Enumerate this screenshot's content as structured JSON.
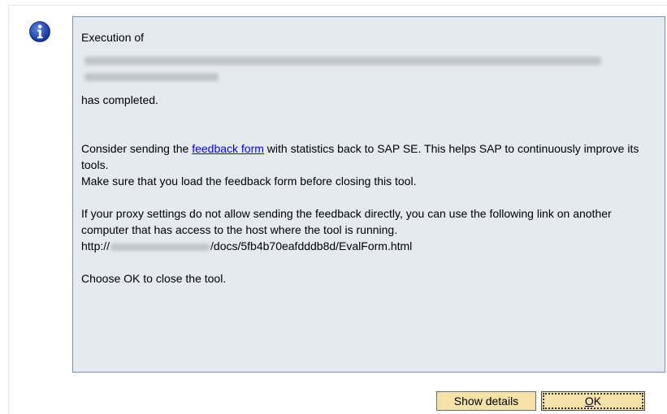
{
  "icons": {
    "info": "info-icon"
  },
  "colors": {
    "panel_bg": "#e5eaf0",
    "panel_border": "#7c92ad",
    "button_bg": "#f4e2a8",
    "link": "#0000ee",
    "info_icon": "#1a3fa8"
  },
  "message": {
    "line1": "Execution of",
    "completed": "has completed.",
    "feedback_prefix": "Consider sending the ",
    "feedback_link": "feedback form",
    "feedback_suffix": " with statistics back to SAP SE. This helps SAP to continuously improve its tools.",
    "load_note": "Make sure that you load the feedback form before closing this tool.",
    "proxy_note": "If your proxy settings do not allow sending the feedback directly, you can use the following link on another computer that has access to the host where the tool is running.",
    "url_prefix": "http://",
    "url_suffix": "/docs/5fb4b70eafdddb8d/EvalForm.html",
    "close_note": "Choose OK to close the tool."
  },
  "buttons": {
    "details_label": "Show details",
    "ok_mnemonic": "O",
    "ok_rest": "K"
  }
}
